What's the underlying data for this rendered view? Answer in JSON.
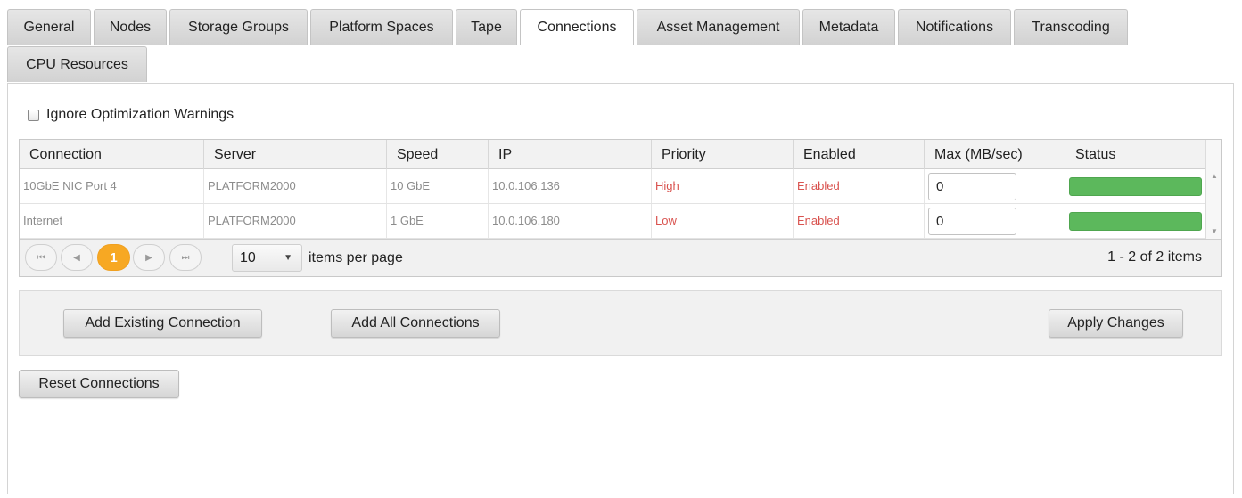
{
  "tabs": [
    {
      "label": "General"
    },
    {
      "label": "Nodes"
    },
    {
      "label": "Storage Groups"
    },
    {
      "label": "Platform Spaces"
    },
    {
      "label": "Tape"
    },
    {
      "label": "Connections",
      "active": true
    },
    {
      "label": "Asset Management"
    },
    {
      "label": "Metadata"
    },
    {
      "label": "Notifications"
    },
    {
      "label": "Transcoding"
    },
    {
      "label": "CPU Resources"
    }
  ],
  "options": {
    "ignore_warnings_label": "Ignore Optimization Warnings",
    "ignore_warnings_checked": false
  },
  "grid": {
    "columns": [
      "Connection",
      "Server",
      "Speed",
      "IP",
      "Priority",
      "Enabled",
      "Max (MB/sec)",
      "Status"
    ],
    "rows": [
      {
        "connection": "10GbE NIC Port 4",
        "server": "PLATFORM2000",
        "speed": "10 GbE",
        "ip": "10.0.106.136",
        "priority": "High",
        "enabled": "Enabled",
        "max": "0",
        "status_fill": 1.0
      },
      {
        "connection": "Internet",
        "server": "PLATFORM2000",
        "speed": "1 GbE",
        "ip": "10.0.106.180",
        "priority": "Low",
        "enabled": "Enabled",
        "max": "0",
        "status_fill": 1.0
      }
    ],
    "status_color": "#5cb85c",
    "priority_color": "#d9534f"
  },
  "pager": {
    "current_page": "1",
    "page_size": "10",
    "items_per_page_label": "items per page",
    "info": "1 - 2 of 2 items"
  },
  "actions": {
    "add_existing": "Add Existing Connection",
    "add_all": "Add All Connections",
    "apply": "Apply Changes",
    "reset": "Reset Connections"
  },
  "colors": {
    "accent": "#f7a823"
  }
}
